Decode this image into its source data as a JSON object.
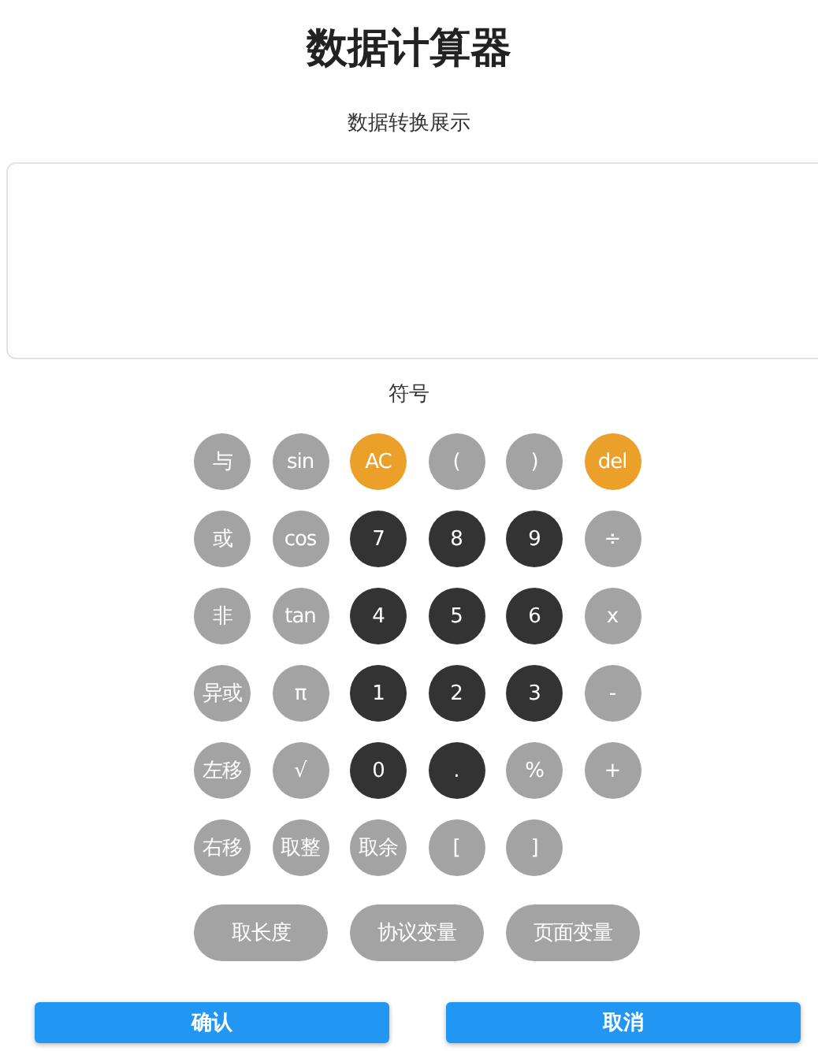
{
  "title": "数据计算器",
  "display": {
    "label": "数据转换展示"
  },
  "keypad": {
    "label": "符号",
    "rows": [
      [
        {
          "label": "与",
          "kind": "func"
        },
        {
          "label": "sin",
          "kind": "func"
        },
        {
          "label": "AC",
          "kind": "accent"
        },
        {
          "label": "(",
          "kind": "func"
        },
        {
          "label": ")",
          "kind": "func"
        },
        {
          "label": "del",
          "kind": "accent"
        }
      ],
      [
        {
          "label": "或",
          "kind": "func"
        },
        {
          "label": "cos",
          "kind": "func"
        },
        {
          "label": "7",
          "kind": "digit"
        },
        {
          "label": "8",
          "kind": "digit"
        },
        {
          "label": "9",
          "kind": "digit"
        },
        {
          "label": "÷",
          "kind": "func"
        }
      ],
      [
        {
          "label": "非",
          "kind": "func"
        },
        {
          "label": "tan",
          "kind": "func"
        },
        {
          "label": "4",
          "kind": "digit"
        },
        {
          "label": "5",
          "kind": "digit"
        },
        {
          "label": "6",
          "kind": "digit"
        },
        {
          "label": "x",
          "kind": "func"
        }
      ],
      [
        {
          "label": "异或",
          "kind": "func"
        },
        {
          "label": "π",
          "kind": "func"
        },
        {
          "label": "1",
          "kind": "digit"
        },
        {
          "label": "2",
          "kind": "digit"
        },
        {
          "label": "3",
          "kind": "digit"
        },
        {
          "label": "-",
          "kind": "func"
        }
      ],
      [
        {
          "label": "左移",
          "kind": "func"
        },
        {
          "label": "√",
          "kind": "func"
        },
        {
          "label": "0",
          "kind": "digit"
        },
        {
          "label": ".",
          "kind": "digit"
        },
        {
          "label": "%",
          "kind": "func"
        },
        {
          "label": "+",
          "kind": "func"
        }
      ],
      [
        {
          "label": "右移",
          "kind": "func"
        },
        {
          "label": "取整",
          "kind": "func"
        },
        {
          "label": "取余",
          "kind": "func"
        },
        {
          "label": "[",
          "kind": "func"
        },
        {
          "label": "]",
          "kind": "func"
        }
      ]
    ],
    "wide_keys": [
      {
        "label": "取长度"
      },
      {
        "label": "协议变量"
      },
      {
        "label": "页面变量"
      }
    ]
  },
  "buttons": [
    {
      "label": "确认"
    },
    {
      "label": "取消"
    }
  ]
}
